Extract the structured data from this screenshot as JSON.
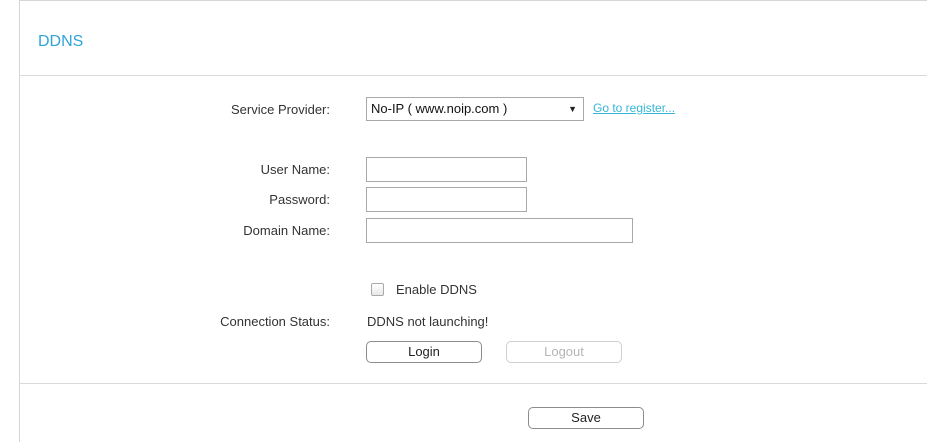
{
  "page": {
    "title": "DDNS"
  },
  "form": {
    "service_provider_label": "Service Provider:",
    "service_provider_value": "No-IP ( www.noip.com )",
    "register_link": "Go to register...",
    "username_label": "User Name:",
    "username_value": "",
    "password_label": "Password:",
    "password_value": "",
    "domain_label": "Domain Name:",
    "domain_value": "",
    "enable_label": "Enable DDNS",
    "enable_checked": false,
    "status_label": "Connection Status:",
    "status_value": "DDNS not launching!",
    "login_label": "Login",
    "logout_label": "Logout",
    "save_label": "Save"
  },
  "colors": {
    "accent": "#2fa4d6",
    "link": "#37b6d8",
    "border": "#d6d6d6"
  },
  "icons": {
    "dropdown": "caret-down-icon"
  }
}
